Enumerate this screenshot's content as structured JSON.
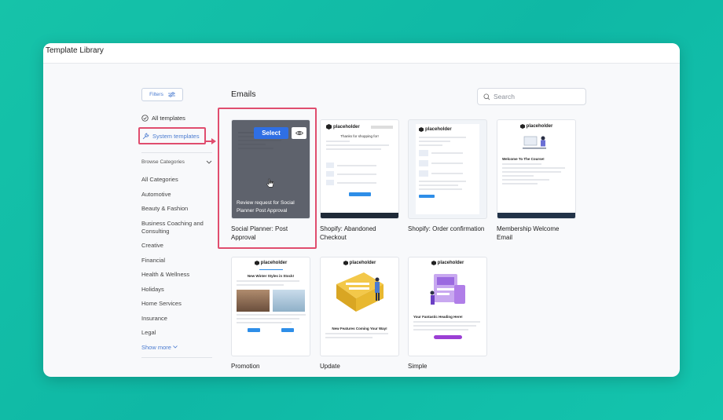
{
  "window": {
    "title": "Template Library"
  },
  "sidebar": {
    "filters_label": "Filters",
    "all_templates": "All templates",
    "system_templates": "System templates",
    "browse_categories": "Browse Categories",
    "categories": [
      "All Categories",
      "Automotive",
      "Beauty & Fashion",
      "Business Coaching and Consulting",
      "Creative",
      "Financial",
      "Health & Wellness",
      "Holidays",
      "Home Services",
      "Insurance",
      "Legal"
    ],
    "show_more": "Show more"
  },
  "main": {
    "section_title": "Emails",
    "search_placeholder": "Search",
    "templates": [
      {
        "title": "Social Planner: Post Approval",
        "overlay_text": "Review request for Social Planner Post Approval",
        "select_label": "Select"
      },
      {
        "title": "Shopify: Abandoned Checkout",
        "heading": "Thanks for shopping for!"
      },
      {
        "title": "Shopify: Order confirmation"
      },
      {
        "title": "Membership Welcome Email",
        "heading": "Welcome To The Course!"
      },
      {
        "title": "Promotion",
        "heading": "New Winter Styles in Stock!"
      },
      {
        "title": "Update",
        "heading": "New Features Coming Your Way!"
      },
      {
        "title": "Simple",
        "heading": "Your Fantastic Heading Here!"
      }
    ],
    "logo_text": "placeholder"
  },
  "colors": {
    "accent": "#2f6fe4",
    "highlight": "#e04d6e",
    "background": "#16c3a9"
  }
}
